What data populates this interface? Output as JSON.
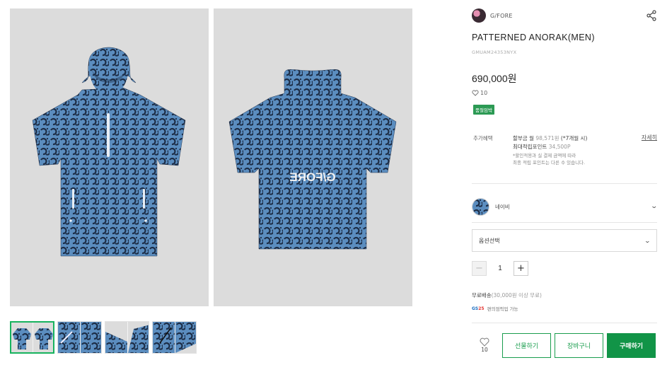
{
  "product": {
    "brand": "G/FORE",
    "title": "PATTERNED ANORAK(MEN)",
    "sku": "GMUAM24353NYX",
    "price": "690,000원",
    "likes": "10",
    "badge": "품절임박"
  },
  "benefits": {
    "label": "추가혜택",
    "installment_prefix": "할부금 월",
    "installment_amount": "98,571원",
    "installment_suffix": "(*7개월 시)",
    "points_label": "최대적립포인트",
    "points_value": "34,500P",
    "note_line1": "*할인적용과 실 결제 금액에 따라",
    "note_line2": "최종 적립 포인트는 다른 수 있습니다.",
    "detail_link": "자세히"
  },
  "color": {
    "selected": "네이비"
  },
  "option_select": {
    "placeholder": "옵션선택"
  },
  "quantity": {
    "value": "1",
    "minus": "−",
    "plus": "+"
  },
  "shipping": {
    "text": "무료배송",
    "condition": "(30,000원 이상 무료)",
    "gs_logo_gs": "GS",
    "gs_logo_25": "25",
    "gs_text": "편의점픽업 가능"
  },
  "actions": {
    "wish_count": "10",
    "gift": "선물하기",
    "cart": "장바구니",
    "buy": "구매하기"
  },
  "gallery": {
    "back_print": "G/FORE"
  },
  "colors": {
    "accent": "#119447",
    "fabric": "#5b8dbf",
    "fabric_dark": "#1c2c45",
    "background": "#dcdcdc"
  }
}
